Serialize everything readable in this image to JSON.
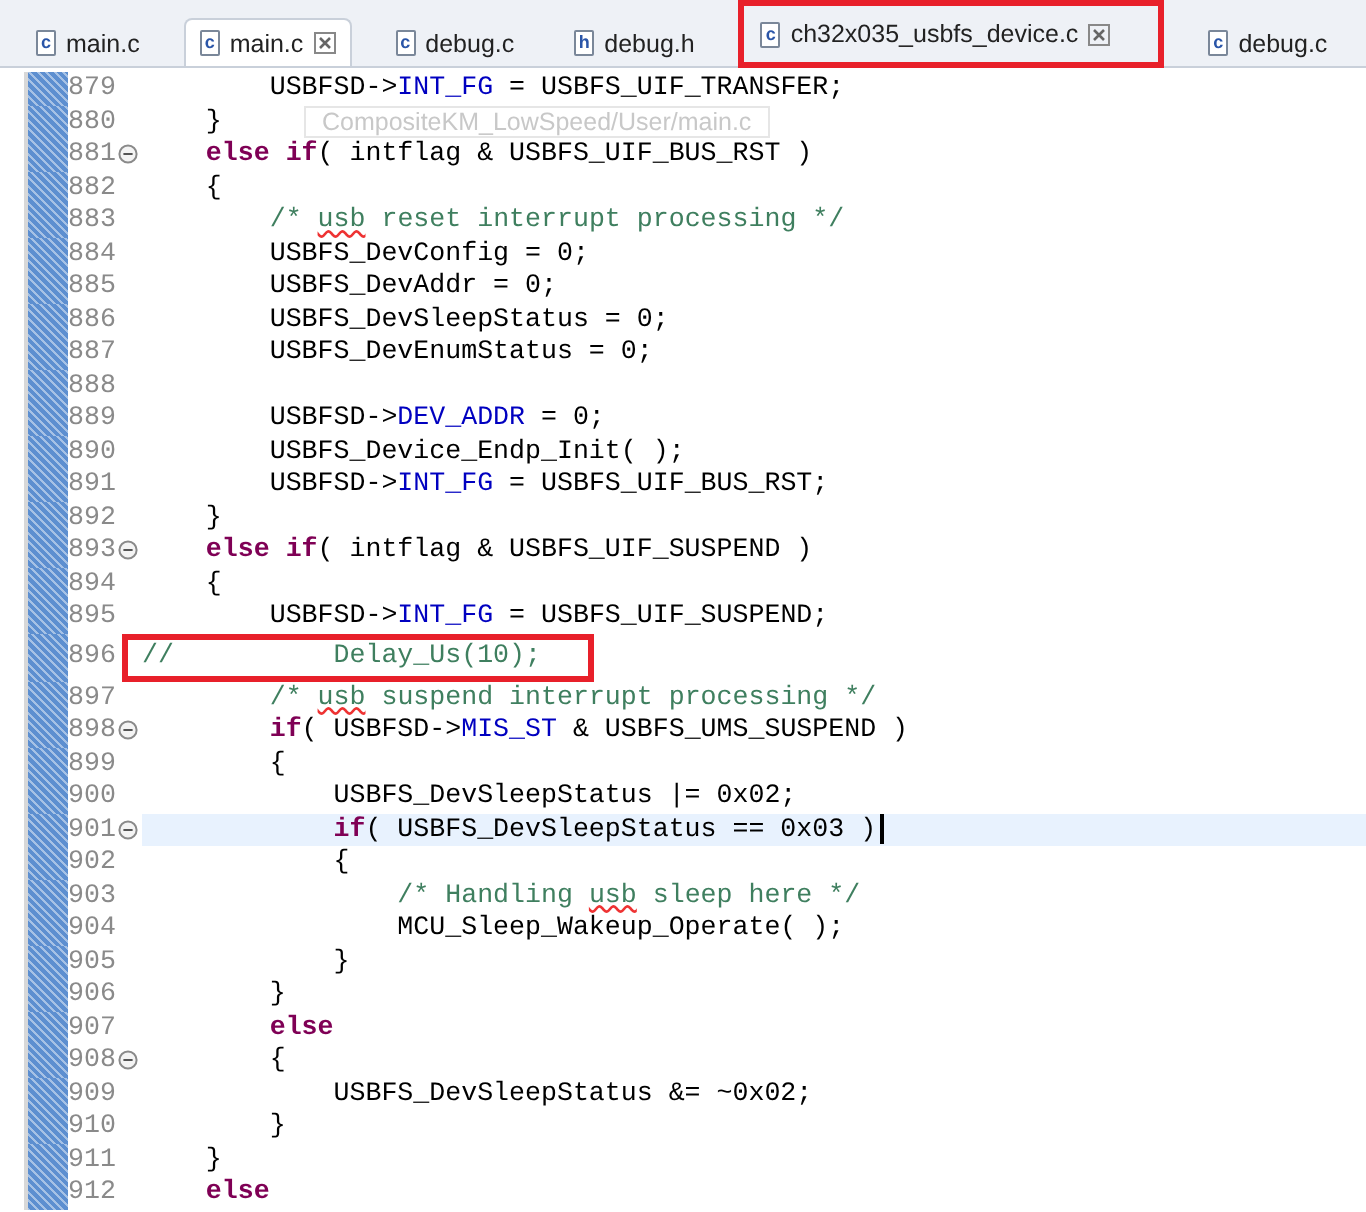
{
  "tabs": [
    {
      "label": "main.c",
      "icon": "c",
      "selected": false,
      "closable": false
    },
    {
      "label": "main.c",
      "icon": "c",
      "selected": true,
      "closable": true
    },
    {
      "label": "debug.c",
      "icon": "c",
      "selected": false,
      "closable": false
    },
    {
      "label": "debug.h",
      "icon": "h",
      "selected": false,
      "closable": false
    },
    {
      "label": "ch32x035_usbfs_device.c",
      "icon": "c",
      "selected": false,
      "closable": true,
      "boxed": true
    },
    {
      "label": "debug.c",
      "icon": "c",
      "selected": false,
      "closable": false
    }
  ],
  "tooltip": "CompositeKM_LowSpeed/User/main.c",
  "lines": [
    {
      "number": "879",
      "fold": false,
      "current": false,
      "segments": [
        {
          "kind": "plain",
          "text": "        USBFSD->"
        },
        {
          "kind": "field",
          "text": "INT_FG"
        },
        {
          "kind": "plain",
          "text": " = USBFS_UIF_TRANSFER;"
        }
      ]
    },
    {
      "number": "880",
      "fold": false,
      "current": false,
      "segments": [
        {
          "kind": "plain",
          "text": "    }"
        }
      ]
    },
    {
      "number": "881",
      "fold": true,
      "current": false,
      "segments": [
        {
          "kind": "keyword",
          "text": "    else if"
        },
        {
          "kind": "plain",
          "text": "( intflag & USBFS_UIF_BUS_RST )"
        }
      ]
    },
    {
      "number": "882",
      "fold": false,
      "current": false,
      "segments": [
        {
          "kind": "plain",
          "text": "    {"
        }
      ]
    },
    {
      "number": "883",
      "fold": false,
      "current": false,
      "segments": [
        {
          "kind": "comment",
          "text": "        /* "
        },
        {
          "kind": "misspelled",
          "text": "usb"
        },
        {
          "kind": "comment",
          "text": " reset interrupt processing */"
        }
      ]
    },
    {
      "number": "884",
      "fold": false,
      "current": false,
      "segments": [
        {
          "kind": "plain",
          "text": "        USBFS_DevConfig = 0;"
        }
      ]
    },
    {
      "number": "885",
      "fold": false,
      "current": false,
      "segments": [
        {
          "kind": "plain",
          "text": "        USBFS_DevAddr = 0;"
        }
      ]
    },
    {
      "number": "886",
      "fold": false,
      "current": false,
      "segments": [
        {
          "kind": "plain",
          "text": "        USBFS_DevSleepStatus = 0;"
        }
      ]
    },
    {
      "number": "887",
      "fold": false,
      "current": false,
      "segments": [
        {
          "kind": "plain",
          "text": "        USBFS_DevEnumStatus = 0;"
        }
      ]
    },
    {
      "number": "888",
      "fold": false,
      "current": false
    },
    {
      "number": "889",
      "fold": false,
      "current": false,
      "segments": [
        {
          "kind": "plain",
          "text": "        USBFSD->"
        },
        {
          "kind": "field",
          "text": "DEV_ADDR"
        },
        {
          "kind": "plain",
          "text": " = 0;"
        }
      ]
    },
    {
      "number": "890",
      "fold": false,
      "current": false,
      "segments": [
        {
          "kind": "plain",
          "text": "        USBFS_Device_Endp_Init( );"
        }
      ]
    },
    {
      "number": "891",
      "fold": false,
      "current": false,
      "segments": [
        {
          "kind": "plain",
          "text": "        USBFSD->"
        },
        {
          "kind": "field",
          "text": "INT_FG"
        },
        {
          "kind": "plain",
          "text": " = USBFS_UIF_BUS_RST;"
        }
      ]
    },
    {
      "number": "892",
      "fold": false,
      "current": false,
      "segments": [
        {
          "kind": "plain",
          "text": "    }"
        }
      ]
    },
    {
      "number": "893",
      "fold": true,
      "current": false,
      "segments": [
        {
          "kind": "keyword",
          "text": "    else if"
        },
        {
          "kind": "plain",
          "text": "( intflag & USBFS_UIF_SUSPEND )"
        }
      ]
    },
    {
      "number": "894",
      "fold": false,
      "current": false,
      "segments": [
        {
          "kind": "plain",
          "text": "    {"
        }
      ]
    },
    {
      "number": "895",
      "fold": false,
      "current": false,
      "segments": [
        {
          "kind": "plain",
          "text": "        USBFSD->"
        },
        {
          "kind": "field",
          "text": "INT_FG"
        },
        {
          "kind": "plain",
          "text": " = USBFS_UIF_SUSPEND;"
        }
      ]
    },
    {
      "number": "896",
      "fold": false,
      "current": false,
      "boxed": true,
      "segments": [
        {
          "kind": "comment",
          "text": "//          Delay_Us(10);"
        }
      ]
    },
    {
      "number": "897",
      "fold": false,
      "current": false,
      "segments": [
        {
          "kind": "comment",
          "text": "        /* "
        },
        {
          "kind": "misspelled",
          "text": "usb"
        },
        {
          "kind": "comment",
          "text": " suspend interrupt processing */"
        }
      ]
    },
    {
      "number": "898",
      "fold": true,
      "current": false,
      "segments": [
        {
          "kind": "keyword",
          "text": "        if"
        },
        {
          "kind": "plain",
          "text": "( USBFSD->"
        },
        {
          "kind": "field",
          "text": "MIS_ST"
        },
        {
          "kind": "plain",
          "text": " & USBFS_UMS_SUSPEND )"
        }
      ]
    },
    {
      "number": "899",
      "fold": false,
      "current": false,
      "segments": [
        {
          "kind": "plain",
          "text": "        {"
        }
      ]
    },
    {
      "number": "900",
      "fold": false,
      "current": false,
      "segments": [
        {
          "kind": "plain",
          "text": "            USBFS_DevSleepStatus |= 0x02;"
        }
      ]
    },
    {
      "number": "901",
      "fold": true,
      "current": true,
      "segments": [
        {
          "kind": "keyword",
          "text": "            if"
        },
        {
          "kind": "plain",
          "text": "( USBFS_DevSleepStatus == 0x03 )"
        }
      ]
    },
    {
      "number": "902",
      "fold": false,
      "current": false,
      "segments": [
        {
          "kind": "plain",
          "text": "            {"
        }
      ]
    },
    {
      "number": "903",
      "fold": false,
      "current": false,
      "segments": [
        {
          "kind": "comment",
          "text": "                /* Handling "
        },
        {
          "kind": "misspelled",
          "text": "usb"
        },
        {
          "kind": "comment",
          "text": " sleep here */"
        }
      ]
    },
    {
      "number": "904",
      "fold": false,
      "current": false,
      "segments": [
        {
          "kind": "plain",
          "text": "                MCU_Sleep_Wakeup_Operate( );"
        }
      ]
    },
    {
      "number": "905",
      "fold": false,
      "current": false,
      "segments": [
        {
          "kind": "plain",
          "text": "            }"
        }
      ]
    },
    {
      "number": "906",
      "fold": false,
      "current": false,
      "segments": [
        {
          "kind": "plain",
          "text": "        }"
        }
      ]
    },
    {
      "number": "907",
      "fold": false,
      "current": false,
      "segments": [
        {
          "kind": "keyword",
          "text": "        else"
        }
      ]
    },
    {
      "number": "908",
      "fold": true,
      "current": false,
      "segments": [
        {
          "kind": "plain",
          "text": "        {"
        }
      ]
    },
    {
      "number": "909",
      "fold": false,
      "current": false,
      "segments": [
        {
          "kind": "plain",
          "text": "            USBFS_DevSleepStatus &= ~0x02;"
        }
      ]
    },
    {
      "number": "910",
      "fold": false,
      "current": false,
      "segments": [
        {
          "kind": "plain",
          "text": "        }"
        }
      ]
    },
    {
      "number": "911",
      "fold": false,
      "current": false,
      "segments": [
        {
          "kind": "plain",
          "text": "    }"
        }
      ]
    },
    {
      "number": "912",
      "fold": false,
      "current": false,
      "segments": [
        {
          "kind": "keyword",
          "text": "    else"
        }
      ]
    }
  ]
}
